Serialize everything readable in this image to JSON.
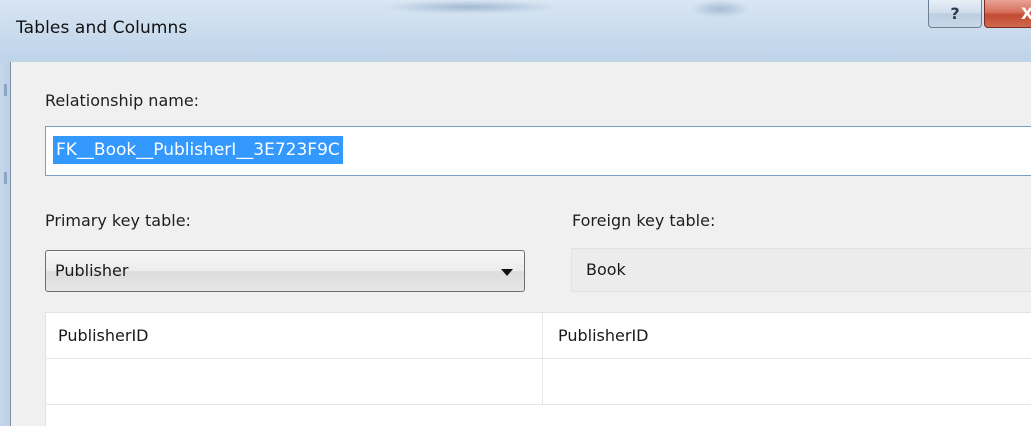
{
  "window": {
    "title": "Tables and Columns",
    "help_label": "?",
    "close_label": "X"
  },
  "relationship": {
    "label": "Relationship name:",
    "value": "FK__Book__PublisherI__3E723F9C"
  },
  "primary_key": {
    "label": "Primary key table:",
    "selected": "Publisher"
  },
  "foreign_key": {
    "label": "Foreign key table:",
    "value": "Book"
  },
  "columns_grid": {
    "rows": [
      [
        "PublisherID",
        "PublisherID"
      ],
      [
        "",
        ""
      ]
    ]
  }
}
